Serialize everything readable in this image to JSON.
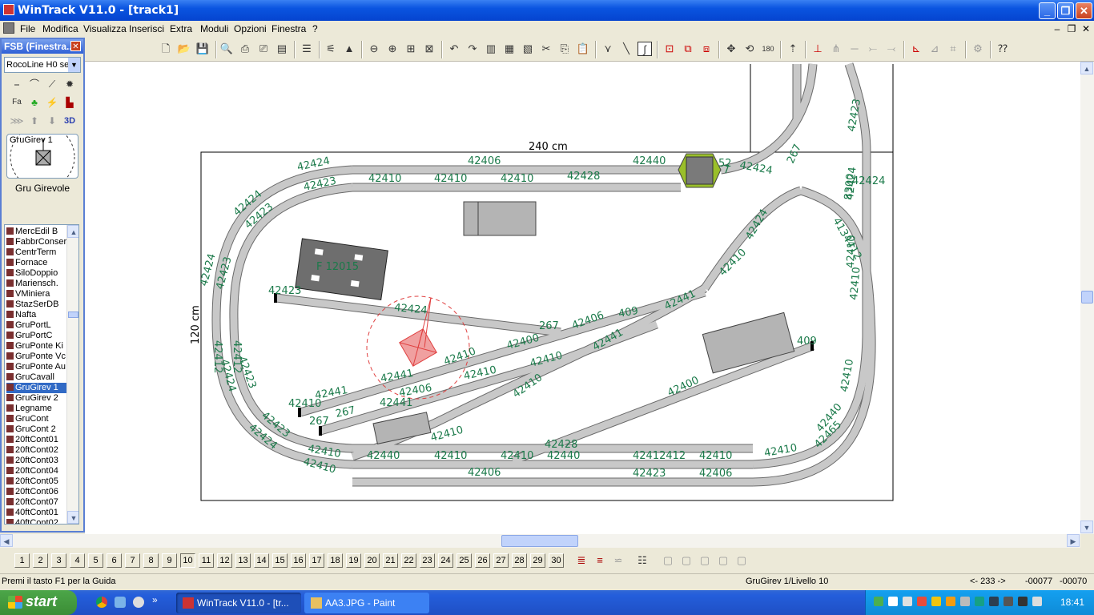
{
  "window": {
    "title": "WinTrack  V11.0 - [track1]"
  },
  "menu": [
    "File",
    "Modifica",
    "Visualizza",
    "Inserisci",
    "Extra",
    "Moduli",
    "Opzioni",
    "Finestra",
    "?"
  ],
  "left_panel": {
    "title": "FSB (Finestra...",
    "library_select": "RocoLine H0 se",
    "preview_label": "GruGirev 1",
    "preview_caption": "Gru Girevole",
    "palette_3d": "3D",
    "items": [
      "MercEdil B",
      "FabbrConser",
      "CentrTerm",
      "Fornace",
      "SiloDoppio",
      "Mariensch.",
      "VMiniera",
      "StazSerDB",
      "Nafta",
      "GruPortL",
      "GruPortC",
      "GruPonte Ki",
      "GruPonte Vc",
      "GruPonte Au",
      "GruCavall",
      "GruGirev 1",
      "GruGirev 2",
      "Legname",
      "GruCont",
      "GruCont 2",
      "20ftCont01",
      "20ftCont02",
      "20ftCont03",
      "20ftCont04",
      "20ftCont05",
      "20ftCont06",
      "20ftCont07",
      "40ftCont01",
      "40ftCont02"
    ],
    "selected_item": "GruGirev 1"
  },
  "canvas": {
    "dim_width": "240 cm",
    "dim_height": "120 cm",
    "track_labels": [
      "42424",
      "42406",
      "42440",
      "42424",
      "42423",
      "42410",
      "42410",
      "42410",
      "42428",
      "42424",
      "42423",
      "42424",
      "42423",
      "42412",
      "42412",
      "42423",
      "42424",
      "42423",
      "42424",
      "42440",
      "42410",
      "42406",
      "42410",
      "42440",
      "42412412",
      "42410",
      "42410",
      "42423",
      "42406",
      "42410",
      "42410",
      "42423",
      "42424",
      "42410",
      "42410",
      "42440",
      "42465",
      "42423",
      "42424",
      "267",
      "42406",
      "409",
      "42441",
      "42400",
      "42441",
      "42410",
      "42410",
      "42441",
      "42410",
      "42441",
      "42441",
      "42410",
      "42400",
      "42406",
      "42410",
      "267",
      "267",
      "42410",
      "42428",
      "409",
      "267",
      "42424",
      "4134412",
      "8300",
      "42410",
      "42410",
      "42424",
      "42410"
    ],
    "building_label": "F 12015",
    "turntable_label": "52",
    "turntable_label2": "7"
  },
  "levels": [
    "1",
    "2",
    "3",
    "4",
    "5",
    "6",
    "7",
    "8",
    "9",
    "10",
    "11",
    "12",
    "13",
    "14",
    "15",
    "16",
    "17",
    "18",
    "19",
    "20",
    "21",
    "22",
    "23",
    "24",
    "25",
    "26",
    "27",
    "28",
    "29",
    "30"
  ],
  "status": {
    "help": "Premi il tasto F1 per la Guida",
    "object": "GruGirev 1/Livello 10",
    "angle": "<- 233 ->",
    "x": "-00077",
    "y": "-00070"
  },
  "taskbar": {
    "start": "start",
    "tasks": [
      "WinTrack  V11.0 - [tr...",
      "AA3.JPG - Paint"
    ],
    "clock": "18:41"
  },
  "colors": {
    "track": "#c8c8c8",
    "label": "#1b7a4a",
    "crane": "#e04040",
    "building": "#707070",
    "turntable": "#9abf2a"
  }
}
